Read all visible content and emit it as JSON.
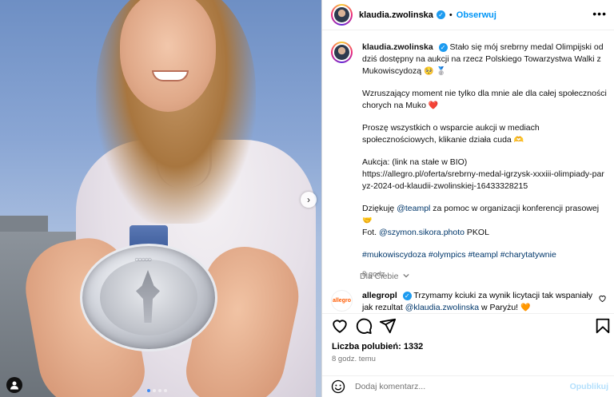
{
  "post": {
    "username": "klaudia.zwolinska",
    "verified_badge": "✓",
    "bullet": "•",
    "follow_label": "Obserwuj",
    "more_icon": "•••"
  },
  "photo": {
    "user_tag_icon": "person-icon",
    "slide_count": 4,
    "active_slide": 1,
    "next_arrow": "›"
  },
  "caption": {
    "username": "klaudia.zwolinska",
    "p1": "Stało się mój srebrny medal Olimpijski od dziś dostępny na aukcji na rzecz Polskiego Towarzystwa Walki z Mukowiscydozą",
    "p1_emoji": "🥺 🥈",
    "p2": "Wzruszający moment nie tylko dla mnie ale dla całej społeczności chorych na Muko",
    "p2_emoji": "❤️",
    "p3": "Proszę wszystkich o wsparcie aukcji w mediach społecznościowych, klikanie działa cuda",
    "p3_emoji": "🫶",
    "p4_label": "Aukcja: (link na stałe w BIO)",
    "p4_link": "https://allegro.pl/oferta/srebrny-medal-igrzysk-xxxiii-olimpiady-paryz-2024-od-klaudii-zwolinskiej-16433328215",
    "p5_before": "Dziękuję ",
    "p5_mention": "@teampl",
    "p5_after": " za pomoc w organizacji konferencji prasowej",
    "p5_emoji": "🤝",
    "p6_before": "Fot. ",
    "p6_mention": "@szymon.sikora.photo",
    "p6_after": " PKOL",
    "hashtags": [
      "#mukowiscydoza",
      "#olympics",
      "#teampl",
      "#charytatywnie"
    ],
    "time": "8 godz."
  },
  "for_you": "Dla Ciebie",
  "comment": {
    "brand_logo": "allegro",
    "username": "allegropl",
    "text_before": "Trzymamy kciuki za wynik licytacji tak wspaniały jak rezultat ",
    "mention": "@klaudia.zwolinska",
    "text_after": " w Paryżu!",
    "emoji": "🧡"
  },
  "actions": {
    "like_icon": "heart-icon",
    "comment_icon": "comment-icon",
    "share_icon": "share-icon",
    "save_icon": "bookmark-icon"
  },
  "likes_label": "Liczba polubień: 1332",
  "post_time": "8 godz. temu",
  "add_comment": {
    "placeholder": "Dodaj komentarz...",
    "publish_label": "Opublikuj"
  }
}
